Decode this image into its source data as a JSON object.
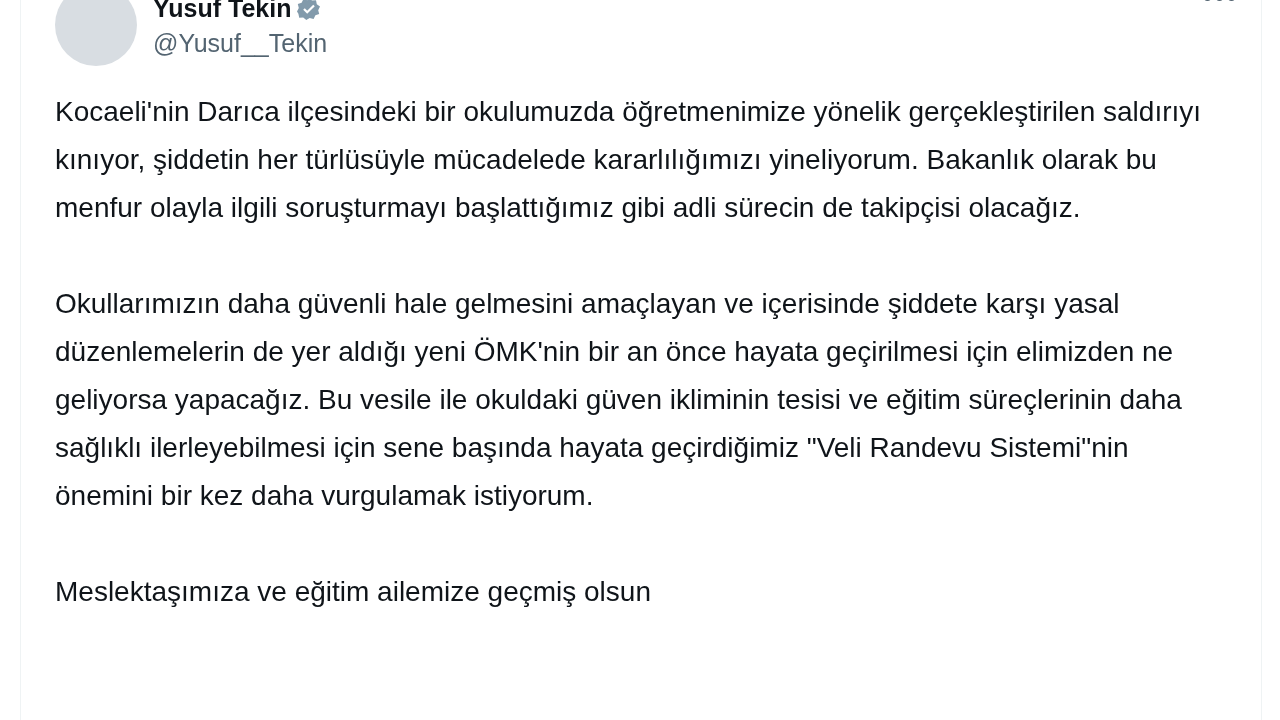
{
  "author": {
    "name": "Yusuf Tekin",
    "verified": true,
    "handle": "@Yusuf__Tekin"
  },
  "paragraphs": [
    "Kocaeli'nin Darıca ilçesindeki bir okulumuzda öğretmenimize yönelik gerçekleştirilen saldırıyı kınıyor, şiddetin her türlüsüyle mücadelede kararlılığımızı yineliyorum. Bakanlık olarak bu menfur olayla ilgili soruşturmayı başlattığımız gibi adli sürecin de takipçisi olacağız.",
    "Okullarımızın daha güvenli hale gelmesini amaçlayan ve içerisinde şiddete karşı yasal düzenlemelerin de yer aldığı yeni ÖMK'nin bir an önce hayata geçirilmesi için elimizden ne geliyorsa yapacağız. Bu vesile ile okuldaki güven ikliminin tesisi ve eğitim süreçlerinin daha sağlıklı ilerleyebilmesi için sene başında hayata geçirdiğimiz \"Veli Randevu Sistemi\"nin önemini bir kez daha vurgulamak istiyorum.",
    "Meslektaşımıza ve eğitim ailemize geçmiş olsun"
  ]
}
